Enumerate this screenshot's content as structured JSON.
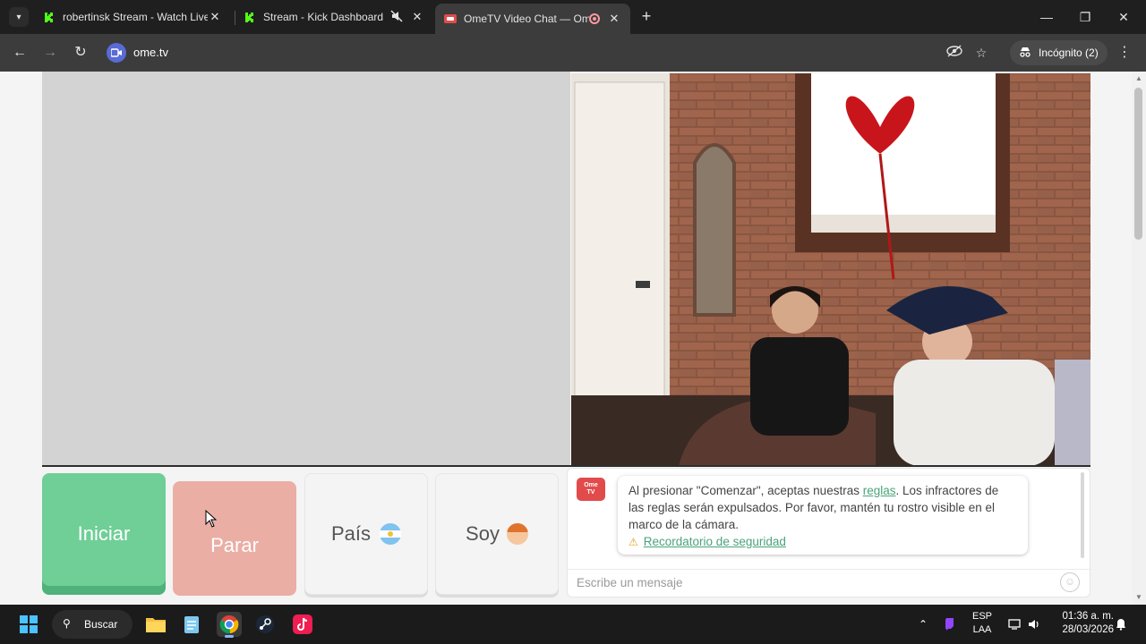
{
  "browser": {
    "tabs": [
      {
        "title": "robertinsk Stream - Watch Live",
        "favicon": "kick-logo",
        "color": "#53fc18"
      },
      {
        "title": "Stream - Kick Dashboard",
        "favicon": "kick-logo",
        "color": "#53fc18"
      },
      {
        "title": "OmeTV Video Chat — Ome",
        "favicon": "ometv-logo",
        "color": "#e24b4b",
        "active": true
      }
    ],
    "url": "ome.tv",
    "incognito_label": "Incógnito (2)"
  },
  "page": {
    "controls": {
      "start_label": "Iniciar",
      "stop_label": "Parar",
      "country_label": "País",
      "country_flag": "argentina-flag",
      "gender_label": "Soy",
      "gender_icon": "boy-avatar"
    },
    "chat": {
      "logo_text_top": "Ome",
      "logo_text_bottom": "TV",
      "notice_prefix": "Al presionar \"Comenzar\", aceptas nuestras ",
      "rules_link": "reglas",
      "notice_suffix": ". Los infractores de las reglas serán expulsados. Por favor, mantén tu rostro visible en el marco de la cámara.",
      "safety_link": "Recordatorio de seguridad",
      "input_placeholder": "Escribe un mensaje"
    },
    "colors": {
      "start": "#6fcf97",
      "stop": "#eaaea5",
      "link": "#4aa37a"
    }
  },
  "taskbar": {
    "search_label": "Buscar",
    "language_top": "ESP",
    "language_bottom": "LAA",
    "time": "01:36 a. m.",
    "date": "28/03/2026"
  }
}
